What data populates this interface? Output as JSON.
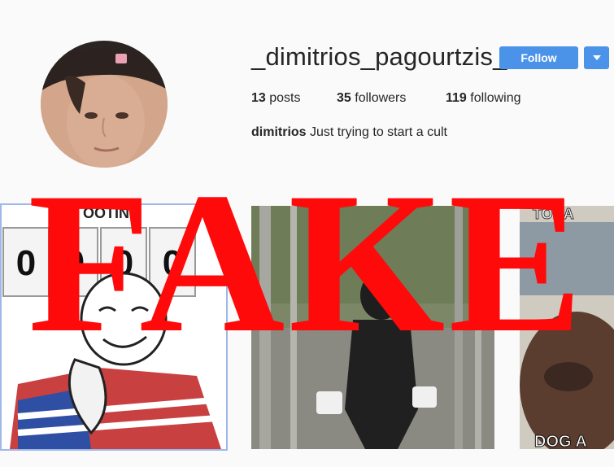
{
  "profile": {
    "username": "_dimitrios_pagourtzis_",
    "follow_label": "Follow",
    "dropdown_icon": "caret-down-icon",
    "posts_count": "13",
    "posts_label": "posts",
    "followers_count": "35",
    "followers_label": "followers",
    "following_count": "119",
    "following_label": "following",
    "bio_name": "dimitrios",
    "bio_text": "Just trying to start a cult"
  },
  "posts": {
    "tile1_header": "OOTING",
    "tile1_digits": [
      "0",
      "0",
      "0",
      "0"
    ],
    "tile3_header": "TODA",
    "tile3_footer": "DOG A"
  },
  "overlay": {
    "text": "FAKE",
    "color": "#ff0a0a"
  },
  "colors": {
    "accent": "#4b93e9",
    "background": "#fafafa"
  }
}
